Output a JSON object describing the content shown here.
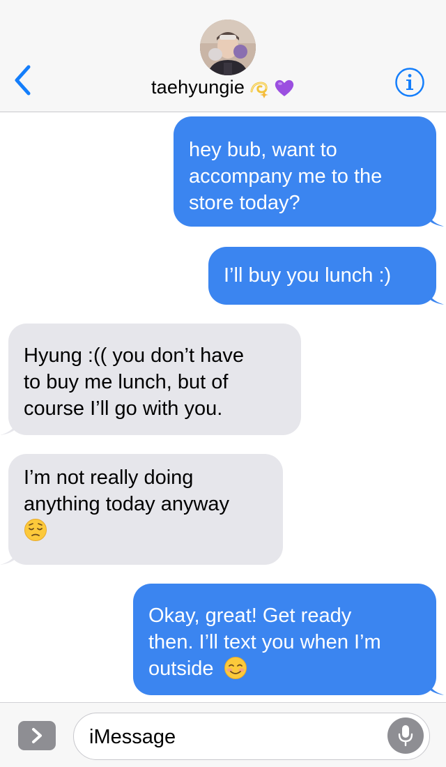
{
  "header": {
    "contact_name": "taehyungie",
    "name_emojis": [
      "dizzy-emoji",
      "purple-heart-emoji"
    ],
    "back_icon": "chevron-left-icon",
    "info_icon": "info-icon"
  },
  "messages": [
    {
      "direction": "outgoing",
      "text": "hey bub, want to\naccompany me to the\nstore today?"
    },
    {
      "direction": "outgoing",
      "text": "I’ll buy you lunch :)"
    },
    {
      "direction": "incoming",
      "text": "Hyung :(( you don’t have\nto buy me lunch, but of\ncourse I’ll go with you."
    },
    {
      "direction": "incoming",
      "text": "I’m not really doing\nanything today anyway",
      "trailing_emoji": "pensive-face-emoji"
    },
    {
      "direction": "outgoing",
      "text": "Okay, great! Get ready\nthen. I’ll text you when I’m\noutside",
      "trailing_emoji": "smiling-face-emoji"
    }
  ],
  "input_bar": {
    "placeholder": "iMessage",
    "apps_icon": "chevron-right-icon",
    "mic_icon": "microphone-icon"
  },
  "colors": {
    "outgoing_bubble": "#3b85f0",
    "incoming_bubble": "#e6e6eb",
    "accent": "#147efb",
    "header_bg": "#f7f7f7"
  }
}
